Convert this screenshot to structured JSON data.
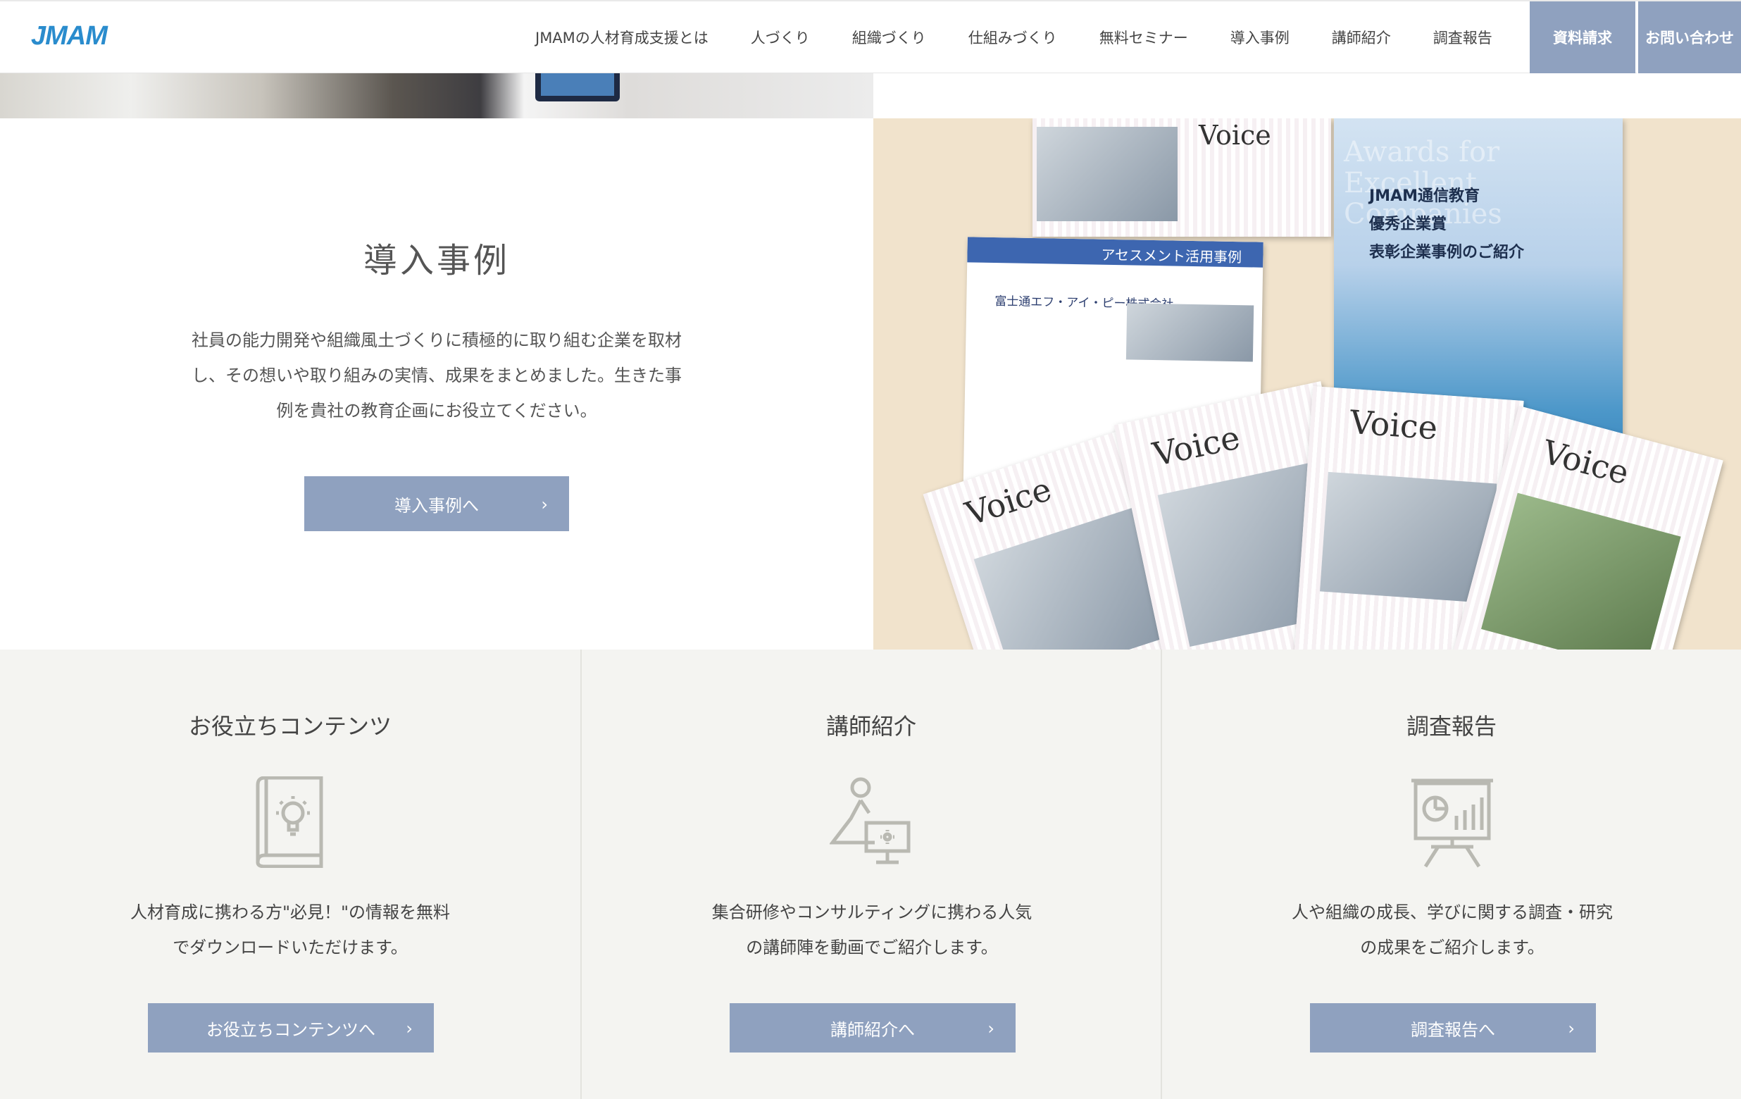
{
  "header": {
    "logo": "JMAM",
    "nav": [
      "JMAMの人材育成支援とは",
      "人づくり",
      "組織づくり",
      "仕組みづくり",
      "無料セミナー",
      "導入事例",
      "講師紹介",
      "調査報告"
    ],
    "cta_documents": "資料請求",
    "cta_contact": "お問い合わせ"
  },
  "case_study": {
    "title": "導入事例",
    "description_lines": [
      "社員の能力開発や組織風土づくりに積極的に取り組む企業を取材",
      "し、その想いや取り組みの実情、成果をまとめました。生きた事",
      "例を貴社の教育企画にお役立てください。"
    ],
    "button_label": "導入事例へ",
    "button_chevron": "›",
    "photo": {
      "voice_label": "Voice",
      "assessment_title": "アセスメント活用事例",
      "assessment_company": "富士通エフ・アイ・ピー株式会社",
      "awards_overlay": "Awards for Excellent Companies",
      "blue_doc_lines": [
        "JMAM通信教育",
        "優秀企業賞",
        "表彰企業事例のご紹介"
      ]
    }
  },
  "columns": [
    {
      "title": "お役立ちコンテンツ",
      "icon": "book-lightbulb-icon",
      "description_lines": [
        "人材育成に携わる方\"必見！\"の情報を無料",
        "でダウンロードいただけます。"
      ],
      "button_label": "お役立ちコンテンツへ",
      "button_chevron": "›"
    },
    {
      "title": "講師紹介",
      "icon": "lecturer-monitor-icon",
      "description_lines": [
        "集合研修やコンサルティングに携わる人気",
        "の講師陣を動画でご紹介します。"
      ],
      "button_label": "講師紹介へ",
      "button_chevron": "›"
    },
    {
      "title": "調査報告",
      "icon": "chart-board-icon",
      "description_lines": [
        "人や組織の成長、学びに関する調査・研究",
        "の成果をご紹介します。"
      ],
      "button_label": "調査報告へ",
      "button_chevron": "›"
    }
  ],
  "colors": {
    "accent": "#8fa1bf",
    "logo": "#2a8ccd",
    "bottom_bg": "#f4f4f1",
    "icon_stroke": "#b9b9b2"
  }
}
